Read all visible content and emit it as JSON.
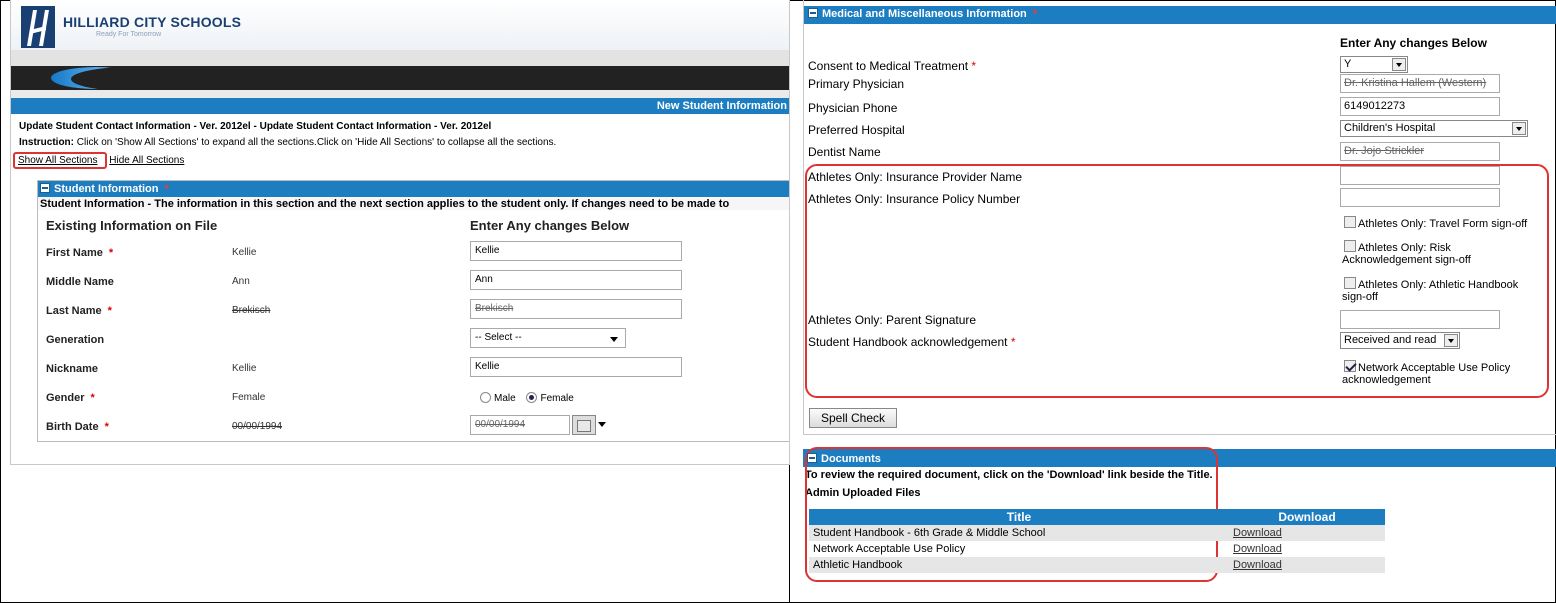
{
  "left_panel": {
    "logo": {
      "name": "HILLIARD CITY SCHOOLS",
      "tagline": "Ready For Tomorrow"
    },
    "banner_title": "New Student Information",
    "form_title": "Update Student Contact Information - Ver. 2012el - Update Student Contact Information - Ver. 2012el",
    "instruction_label": "Instruction:",
    "instruction_text": " Click on 'Show All Sections' to expand all the sections.Click on 'Hide All Sections' to collapse all the sections.",
    "show_all_label": "Show All Sections",
    "hide_all_label": "Hide All Sections",
    "student_section": {
      "title": "Student Information",
      "required_mark": "*",
      "description": "Student Information - The information in this section and the next section applies to the student only. If changes need to be made to",
      "existing_header": "Existing Information on File",
      "changes_header": "Enter Any changes Below",
      "rows": [
        {
          "label": "First Name",
          "required": "*",
          "existing": "Kellie",
          "input": "Kellie"
        },
        {
          "label": "Middle Name",
          "required": "",
          "existing": "Ann",
          "input": "Ann"
        },
        {
          "label": "Last Name",
          "required": "*",
          "existing": "Brekisch",
          "input": "Brekisch"
        },
        {
          "label": "Generation",
          "required": "",
          "existing": "",
          "select": "-- Select --"
        },
        {
          "label": "Nickname",
          "required": "",
          "existing": "Kellie",
          "input": "Kellie"
        },
        {
          "label": "Gender",
          "required": "*",
          "existing": "Female",
          "radio_male": "Male",
          "radio_female": "Female"
        },
        {
          "label": "Birth Date",
          "required": "*",
          "existing": "00/00/1994",
          "input": "00/00/1994"
        }
      ]
    }
  },
  "medical_section": {
    "title": "Medical and Miscellaneous Information",
    "required_mark": "*",
    "changes_header": "Enter Any changes Below",
    "consent_label": "Consent to Medical Treatment",
    "consent_value": "Y",
    "physician_label": "Primary Physician",
    "physician_value": "Dr. Kristina Hallem (Western)",
    "physician_phone_label": "Physician Phone",
    "physician_phone_value": "6149012273",
    "hospital_label": "Preferred Hospital",
    "hospital_value": "Children's Hospital",
    "dentist_label": "Dentist Name",
    "dentist_value": "Dr. Jojo Strickler",
    "insurance_name_label": "Athletes Only: Insurance Provider Name",
    "insurance_policy_label": "Athletes Only: Insurance Policy Number",
    "travel_form_label": "Athletes Only: Travel Form sign-off",
    "risk_label": "Athletes Only: Risk Acknowledgement sign-off",
    "handbook_athletic_label": "Athletes Only: Athletic Handbook sign-off",
    "parent_signature_label": "Athletes Only: Parent Signature",
    "student_handbook_label": "Student Handbook acknowledgement",
    "student_handbook_value": "Received and read",
    "network_policy_label": "Network Acceptable Use Policy acknowledgement",
    "spell_check_label": "Spell Check"
  },
  "documents_section": {
    "title": "Documents",
    "description": "To review the required document, click on the 'Download' link beside the Title.",
    "subheading": "Admin Uploaded Files",
    "col_title": "Title",
    "col_download": "Download",
    "rows": [
      {
        "title": "Student Handbook - 6th Grade & Middle School",
        "link": "Download"
      },
      {
        "title": "Network Acceptable Use Policy",
        "link": "Download"
      },
      {
        "title": "Athletic Handbook",
        "link": "Download"
      }
    ]
  },
  "colors": {
    "header_blue": "#1d7dc1",
    "highlight_red": "#dd3333"
  }
}
